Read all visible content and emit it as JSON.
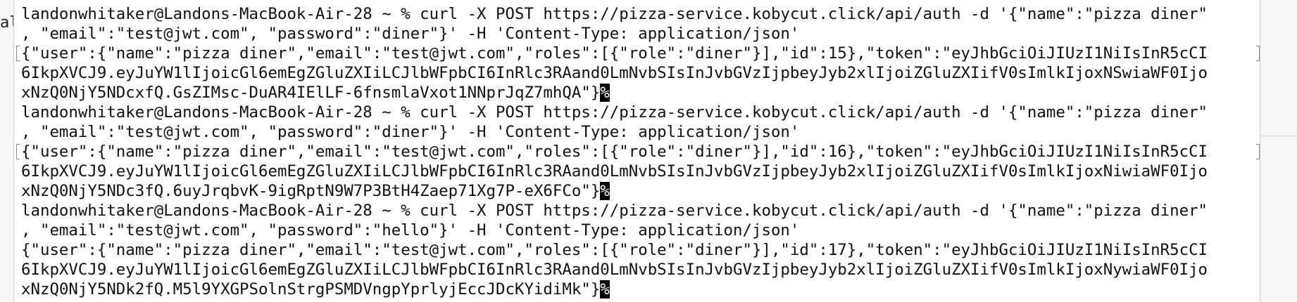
{
  "background": {
    "left_text": "al"
  },
  "terminal": {
    "lines": [
      "landonwhitaker@Landons-MacBook-Air-28 ~ % curl -X POST https://pizza-service.kobycut.click/api/auth -d '{\"name\":\"pizza diner\"",
      ", \"email\":\"test@jwt.com\", \"password\":\"diner\"}' -H 'Content-Type: application/json'",
      "{\"user\":{\"name\":\"pizza diner\",\"email\":\"test@jwt.com\",\"roles\":[{\"role\":\"diner\"}],\"id\":15},\"token\":\"eyJhbGciOiJIUzI1NiIsInR5cCI",
      "6IkpXVCJ9.eyJuYW1lIjoicGl6emEgZGluZXIiLCJlbWFpbCI6InRlc3RAand0LmNvbSIsInJvbGVzIjpbeyJyb2xlIjoiZGluZXIifV0sImlkIjoxNSwiaWF0Ijo",
      "xNzQ0NjY5NDcxfQ.GsZIMsc-DuAR4IElLF-6fnsmlaVxot1NNprJqZ7mhQA\"}",
      "landonwhitaker@Landons-MacBook-Air-28 ~ % curl -X POST https://pizza-service.kobycut.click/api/auth -d '{\"name\":\"pizza diner\"",
      ", \"email\":\"test@jwt.com\", \"password\":\"diner\"}' -H 'Content-Type: application/json'",
      "{\"user\":{\"name\":\"pizza diner\",\"email\":\"test@jwt.com\",\"roles\":[{\"role\":\"diner\"}],\"id\":16},\"token\":\"eyJhbGciOiJIUzI1NiIsInR5cCI",
      "6IkpXVCJ9.eyJuYW1lIjoicGl6emEgZGluZXIiLCJlbWFpbCI6InRlc3RAand0LmNvbSIsInJvbGVzIjpbeyJyb2xlIjoiZGluZXIifV0sImlkIjoxNiwiaWF0Ijo",
      "xNzQ0NjY5NDc3fQ.6uyJrqbvK-9igRptN9W7P3BtH4Zaep71Xg7P-eX6FCo\"}",
      "landonwhitaker@Landons-MacBook-Air-28 ~ % curl -X POST https://pizza-service.kobycut.click/api/auth -d '{\"name\":\"pizza diner\"",
      ", \"email\":\"test@jwt.com\", \"password\":\"hello\"}' -H 'Content-Type: application/json'",
      "{\"user\":{\"name\":\"pizza diner\",\"email\":\"test@jwt.com\",\"roles\":[{\"role\":\"diner\"}],\"id\":17},\"token\":\"eyJhbGciOiJIUzI1NiIsInR5cCI",
      "6IkpXVCJ9.eyJuYW1lIjoicGl6emEgZGluZXIiLCJlbWFpbCI6InRlc3RAand0LmNvbSIsInJvbGVzIjpbeyJyb2xlIjoiZGluZXIifV0sImlkIjoxNywiaWF0Ijo",
      "xNzQ0NjY5NDk2fQ.M5l9YXGPSolnStrgPSMDVngpYprlyjEccJDcKYidiMk\"}"
    ],
    "cursor_char": "%"
  }
}
